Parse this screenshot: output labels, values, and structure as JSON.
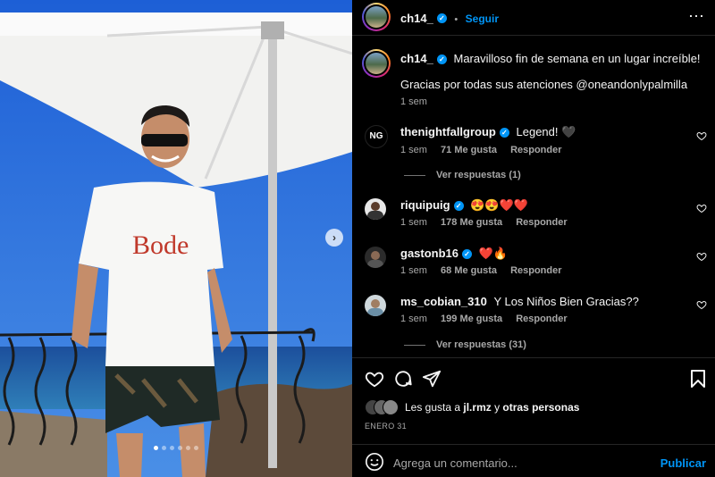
{
  "post": {
    "author": "ch14_",
    "follow_label": "Seguir",
    "more_label": "⋯",
    "caption_line1": "Maravilloso fin de semana en un lugar increíble!",
    "caption_line2": "Gracias por todas sus atenciones @oneandonlypalmilla",
    "caption_time": "1 sem",
    "photo_shirt_text": "Bode",
    "likes_text_prefix": "Les gusta a ",
    "likes_user": "jl.rmz",
    "likes_text_mid": " y ",
    "likes_others": "otras personas",
    "date": "ENERO 31",
    "comment_placeholder": "Agrega un comentario...",
    "publish_label": "Publicar"
  },
  "comments": [
    {
      "user": "thenightfallgroup",
      "text": "Legend! 🖤",
      "time": "1 sem",
      "likes": "71 Me gusta",
      "reply": "Responder",
      "view_replies": "Ver respuestas (1)"
    },
    {
      "user": "riquipuig",
      "text": "😍😍❤️❤️",
      "time": "1 sem",
      "likes": "178 Me gusta",
      "reply": "Responder"
    },
    {
      "user": "gastonb16",
      "text": "❤️🔥",
      "time": "1 sem",
      "likes": "68 Me gusta",
      "reply": "Responder"
    },
    {
      "user": "ms_cobian_310",
      "text": "Y Los Niños Bien Gracias??",
      "time": "1 sem",
      "likes": "199 Me gusta",
      "reply": "Responder",
      "view_replies": "Ver respuestas (31)"
    }
  ],
  "colors": {
    "accent": "#0095f6",
    "background": "#000000",
    "secondary_text": "#a8a8a8"
  },
  "carousel": {
    "slide_count": 6,
    "active_index": 0
  }
}
